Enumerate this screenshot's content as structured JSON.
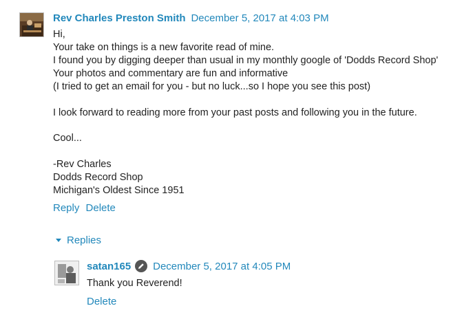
{
  "comment": {
    "author": "Rev Charles Preston Smith",
    "timestamp": "December 5, 2017 at 4:03 PM",
    "avatar_icon": "user-photo-avatar",
    "lines": [
      "Hi,",
      "Your take on things is a new favorite read of mine.",
      "I found you by digging deeper than usual in my monthly google of 'Dodds Record Shop'",
      "Your photos and commentary are fun and informative",
      "(I tried to get an email for you - but no luck...so I hope you see this post)",
      "",
      "I look forward to reading more from your past posts and following you in the future.",
      "",
      "Cool...",
      "",
      "-Rev Charles",
      "Dodds Record Shop",
      "Michigan's Oldest Since 1951"
    ],
    "reply_label": "Reply",
    "delete_label": "Delete"
  },
  "replies": {
    "toggle_label": "Replies",
    "items": [
      {
        "author": "satan165",
        "badge_icon": "pencil-author-badge-icon",
        "timestamp": "December 5, 2017 at 4:05 PM",
        "text": "Thank you Reverend!",
        "delete_label": "Delete"
      }
    ]
  },
  "colors": {
    "link": "#2288bb",
    "text": "#222222",
    "badge": "#555555"
  }
}
